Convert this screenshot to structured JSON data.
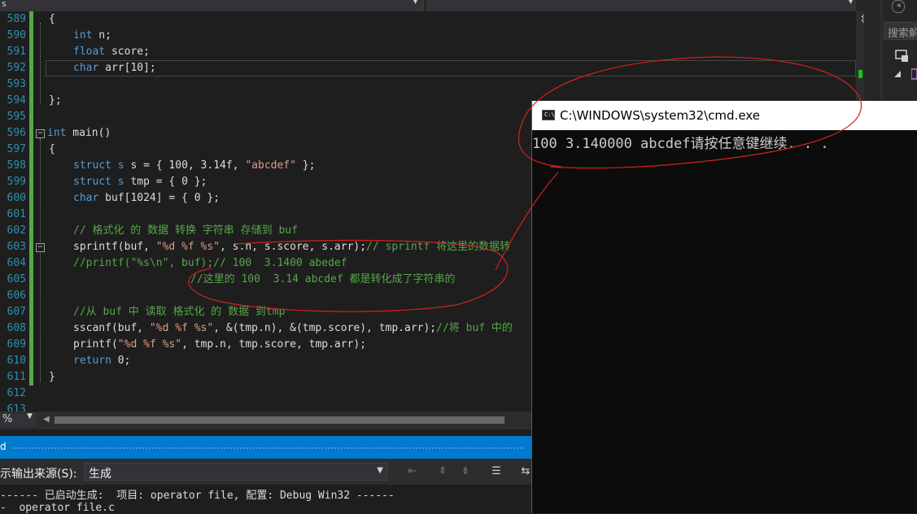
{
  "editor": {
    "nav_left_label": "s",
    "line_numbers": [
      "589",
      "590",
      "591",
      "592",
      "593",
      "594",
      "595",
      "596",
      "597",
      "598",
      "599",
      "600",
      "601",
      "602",
      "603",
      "604",
      "605",
      "606",
      "607",
      "608",
      "609",
      "610",
      "611",
      "612",
      "613"
    ],
    "lines": {
      "l589": "{",
      "l590_kw": "int",
      "l590_rest": " n;",
      "l591_kw": "float",
      "l591_rest": " score;",
      "l592_kw": "char",
      "l592_rest": " arr[10];",
      "l594": "};",
      "l596_kw": "int",
      "l596_rest": " main()",
      "l597": "{",
      "l598_kw": "struct",
      "l598_a": " s",
      "l598_b": " s = { 100, 3.14f, ",
      "l598_str": "\"abcdef\"",
      "l598_c": " };",
      "l599_kw": "struct",
      "l599_a": " s",
      "l599_b": " tmp = { 0 };",
      "l600_kw": "char",
      "l600_b": " buf[1024] = { 0 };",
      "l602_cm": "// 格式化 的 数据 转换 字符串 存储到 buf",
      "l603_a": "sprintf(buf, ",
      "l603_str": "\"%d %f %s\"",
      "l603_b": ", s.n, s.score, s.arr);",
      "l603_cm": "// sprintf 将这里的数据转",
      "l604_cm": "//printf(\"%s\\n\", buf);// 100  3.1400 abedef",
      "l605_cm": "//这里的 100  3.14 abcdef 都是转化成了字符串的",
      "l607_cm": "//从 buf 中 读取 格式化 的 数据 到tmp",
      "l608_a": "sscanf(buf, ",
      "l608_str": "\"%d %f %s\"",
      "l608_b": ", &(tmp.n), &(tmp.score), tmp.arr);",
      "l608_cm": "//将 buf 中的",
      "l609_a": "printf(",
      "l609_str": "\"%d %f %s\"",
      "l609_b": ", tmp.n, tmp.score, tmp.arr);",
      "l610_kw": "return",
      "l610_b": " 0;",
      "l611": "}"
    },
    "zoom": "%"
  },
  "side_panel": {
    "search_placeholder": "搜索解"
  },
  "output_panel": {
    "title_fragment": "d",
    "source_label": "示输出来源(S):",
    "source_value": "生成",
    "lines": [
      "------ 已启动生成:  项目: operator file, 配置: Debug Win32 ------",
      "-  operator file.c"
    ]
  },
  "cmd_window": {
    "title": "C:\\WINDOWS\\system32\\cmd.exe",
    "output": "100 3.140000 abcdef请按任意键继续. . ."
  }
}
